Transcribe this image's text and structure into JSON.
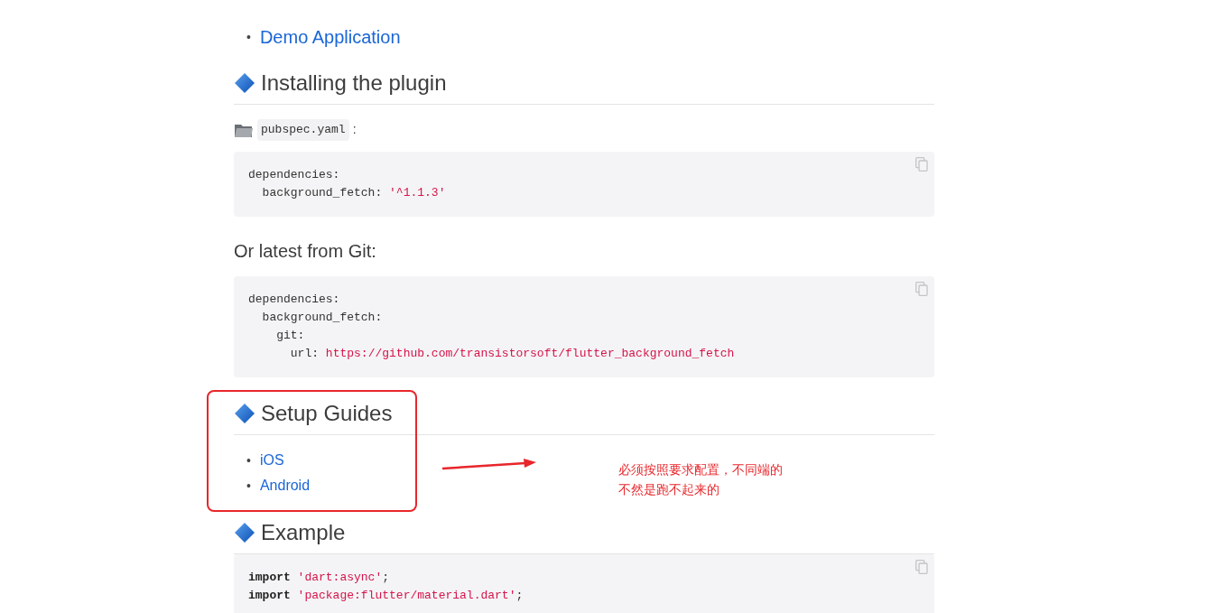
{
  "blocks": [
    {
      "kind": "top_list",
      "items": [
        {
          "marker": "•",
          "label": "Demo Application"
        }
      ]
    },
    {
      "kind": "heading",
      "text": "Installing the plugin"
    },
    {
      "kind": "file_label",
      "file": "pubspec.yaml",
      "suffix": ":"
    },
    {
      "kind": "code",
      "lines": [
        [
          {
            "text": "dependencies:",
            "kind": "plain"
          }
        ],
        [
          {
            "text": "  background_fetch: ",
            "kind": "plain"
          },
          {
            "text": "'^1.1.3'",
            "kind": "string"
          }
        ]
      ]
    },
    {
      "kind": "paragraph",
      "text": "Or latest from Git:"
    },
    {
      "kind": "code",
      "lines": [
        [
          {
            "text": "dependencies:",
            "kind": "plain"
          }
        ],
        [
          {
            "text": "  background_fetch:",
            "kind": "plain"
          }
        ],
        [
          {
            "text": "    git:",
            "kind": "plain"
          }
        ],
        [
          {
            "text": "      url: ",
            "kind": "plain"
          },
          {
            "text": "https://github.com/transistorsoft/flutter_background_fetch",
            "kind": "string"
          }
        ]
      ]
    },
    {
      "kind": "heading",
      "text": "Setup Guides"
    },
    {
      "kind": "guide_list",
      "items": [
        {
          "marker": "•",
          "label": "iOS"
        },
        {
          "marker": "•",
          "label": "Android"
        }
      ]
    },
    {
      "kind": "heading",
      "text": "Example"
    },
    {
      "kind": "code",
      "lines": [
        [
          {
            "text": "import ",
            "kind": "keyword"
          },
          {
            "text": "'dart:async'",
            "kind": "string"
          },
          {
            "text": ";",
            "kind": "plain"
          }
        ],
        [
          {
            "text": "import ",
            "kind": "keyword"
          },
          {
            "text": "'package:flutter/material.dart'",
            "kind": "string"
          },
          {
            "text": ";",
            "kind": "plain"
          }
        ]
      ]
    }
  ],
  "annotation": {
    "note": "必须按照要求配置，不同端的不然是跑不起来的"
  }
}
